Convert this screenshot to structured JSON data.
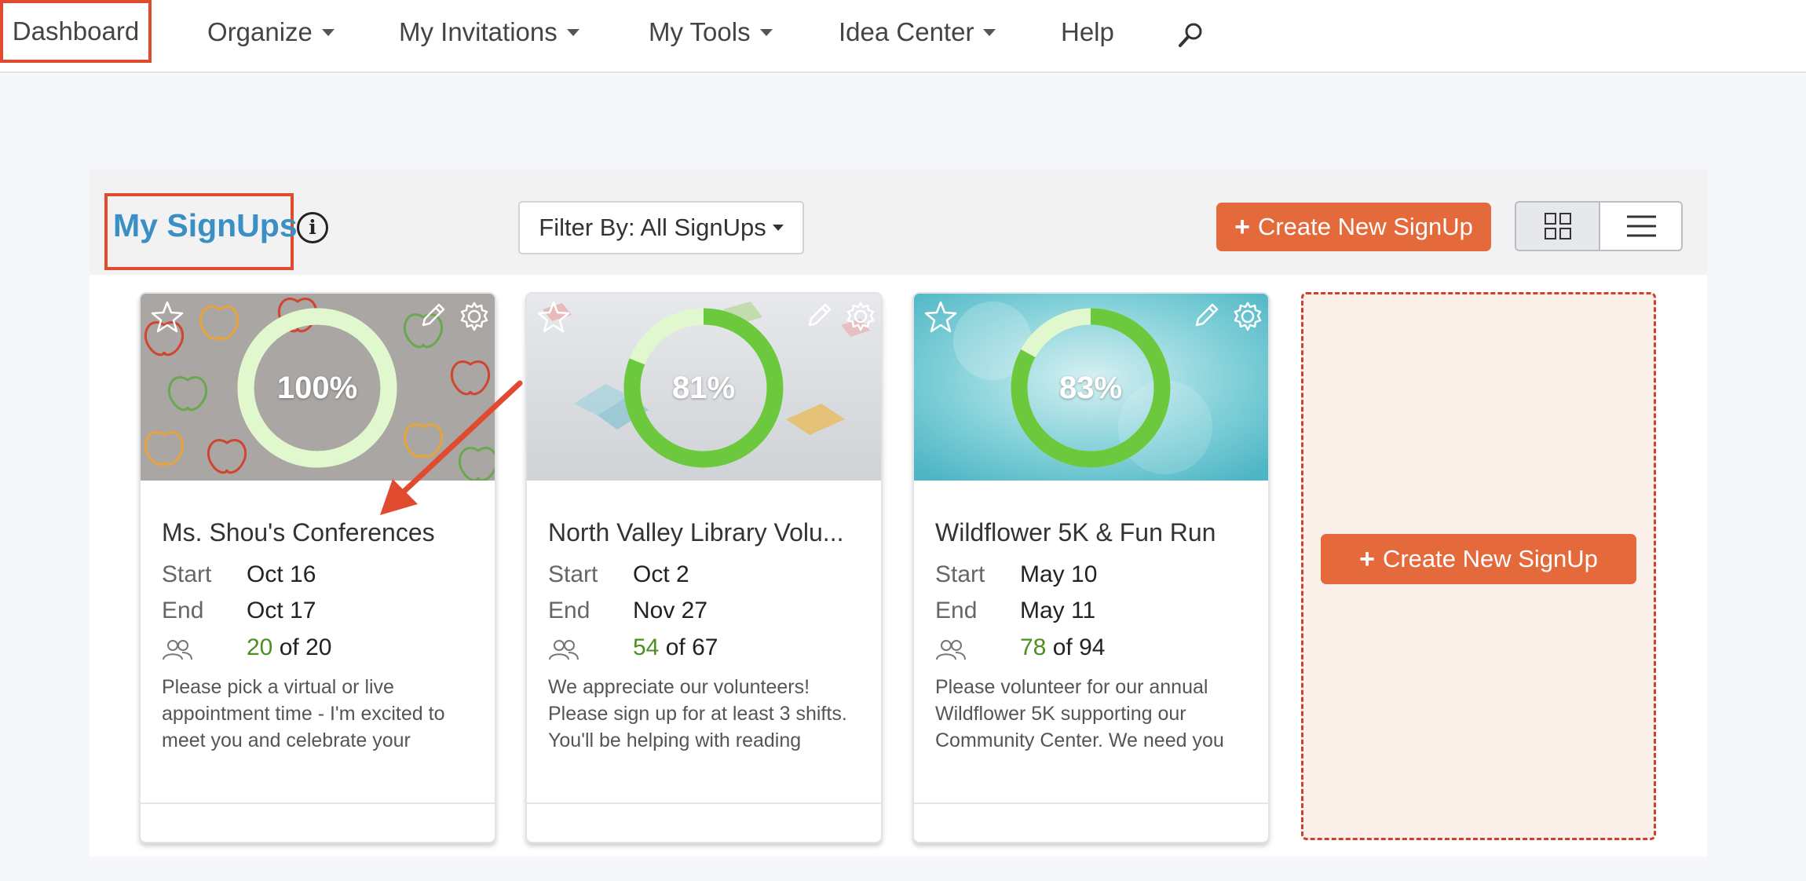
{
  "nav": {
    "dashboard": "Dashboard",
    "organize": "Organize",
    "invitations": "My Invitations",
    "tools": "My Tools",
    "ideas": "Idea Center",
    "help": "Help"
  },
  "header": {
    "title": "My SignUps",
    "info_icon": "i",
    "filter_label": "Filter By: All SignUps",
    "create_label": "Create New SignUp",
    "view_modes": [
      "grid",
      "list"
    ],
    "selected_view": "grid"
  },
  "labels": {
    "start": "Start",
    "end": "End"
  },
  "cards": [
    {
      "title": "Ms. Shou's Conferences",
      "percent": "100%",
      "progress": 1.0,
      "start": "Oct 16",
      "end": "Oct 17",
      "filled": "20",
      "total_text": "of 20",
      "description": "Please pick a virtual or live appointment time - I'm excited to meet you and celebrate your"
    },
    {
      "title": "North Valley Library Volu...",
      "percent": "81%",
      "progress": 0.81,
      "start": "Oct 2",
      "end": "Nov 27",
      "filled": "54",
      "total_text": "of 67",
      "description": "We appreciate our volunteers! Please sign up for at least 3 shifts. You'll be helping with reading"
    },
    {
      "title": "Wildflower 5K & Fun Run",
      "percent": "83%",
      "progress": 0.83,
      "start": "May 10",
      "end": "May 11",
      "filled": "78",
      "total_text": "of 94",
      "description": "Please volunteer for our annual Wildflower 5K supporting our Community Center. We need you"
    }
  ],
  "new_card": {
    "create_label": "Create New SignUp"
  },
  "colors": {
    "accent_orange": "#e46a3c",
    "highlight_red": "#e04a2f",
    "title_blue": "#3a8fc4",
    "progress_green": "#6cc83d",
    "progress_track": "#e1f8cf",
    "count_green": "#4d8f22"
  },
  "icons": {
    "search": "magnifier-icon",
    "favorite": "star-icon",
    "edit": "pencil-icon",
    "settings": "gear-icon",
    "participants": "people-icon",
    "grid_view": "grid-icon",
    "list_view": "list-icon"
  }
}
